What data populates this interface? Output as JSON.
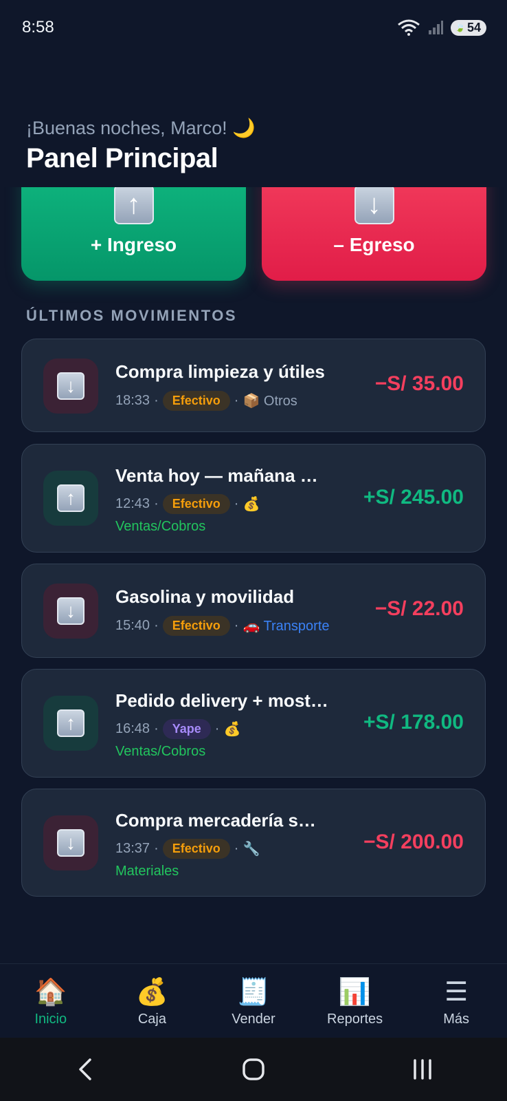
{
  "status": {
    "time": "8:58",
    "battery": "54"
  },
  "header": {
    "greeting": "¡Buenas noches, Marco! 🌙",
    "title": "Panel Principal"
  },
  "actions": {
    "ingreso": "+ Ingreso",
    "egreso": "– Egreso"
  },
  "section_title": "ÚLTIMOS MOVIMIENTOS",
  "transactions": [
    {
      "title": "Compra limpieza y útiles",
      "time": "18:33",
      "method": "Efectivo",
      "category": "📦 Otros",
      "category_line2": "",
      "amount": "−S/ 35.00",
      "direction": "out"
    },
    {
      "title": "Venta hoy — mañana …",
      "time": "12:43",
      "method": "Efectivo",
      "category": "💰",
      "category_line2": "Ventas/Cobros",
      "amount": "+S/ 245.00",
      "direction": "in"
    },
    {
      "title": "Gasolina y movilidad",
      "time": "15:40",
      "method": "Efectivo",
      "category": "🚗 Transporte",
      "category_line2": "",
      "amount": "−S/ 22.00",
      "direction": "out"
    },
    {
      "title": "Pedido delivery + most…",
      "time": "16:48",
      "method": "Yape",
      "category": "💰",
      "category_line2": "Ventas/Cobros",
      "amount": "+S/ 178.00",
      "direction": "in"
    },
    {
      "title": "Compra mercadería s…",
      "time": "13:37",
      "method": "Efectivo",
      "category": "🔧",
      "category_line2": "Materiales",
      "amount": "−S/ 200.00",
      "direction": "out"
    }
  ],
  "nav": [
    {
      "label": "Inicio",
      "icon": "🏠"
    },
    {
      "label": "Caja",
      "icon": "💰"
    },
    {
      "label": "Vender",
      "icon": "🧾"
    },
    {
      "label": "Reportes",
      "icon": "📊"
    },
    {
      "label": "Más",
      "icon": "☰"
    }
  ]
}
